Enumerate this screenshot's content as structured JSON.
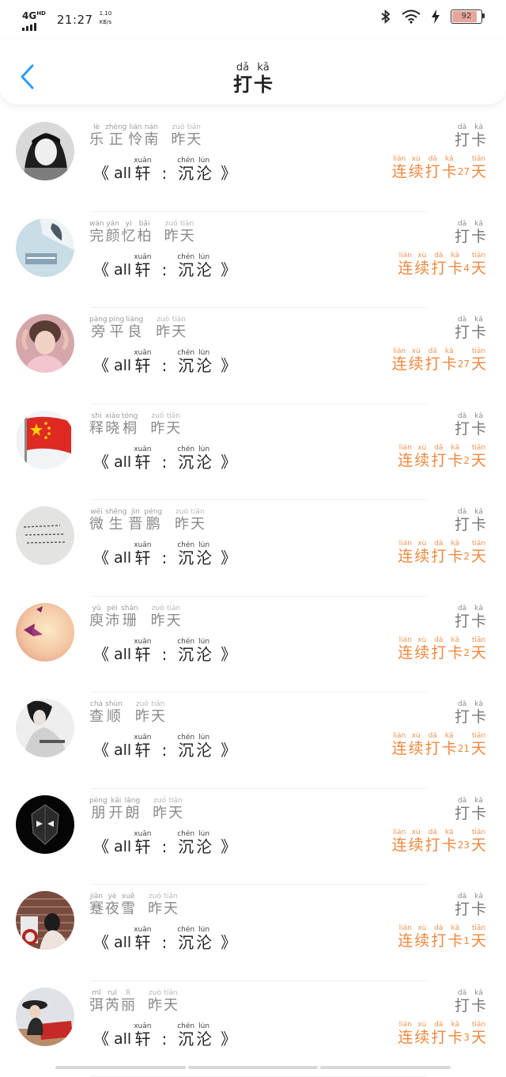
{
  "status": {
    "network": "4G",
    "network_sup": "HD",
    "time": "21:27",
    "speed_value": "1.10",
    "speed_unit": "KB/s",
    "battery": "92",
    "battery_level": 0.92
  },
  "header": {
    "title": [
      {
        "py": "dǎ",
        "hz": "打"
      },
      {
        "py": "kǎ",
        "hz": "卡"
      }
    ],
    "back_icon": "chevron-left-icon"
  },
  "common": {
    "yesterday": [
      {
        "py": "zuó",
        "hz": "昨"
      },
      {
        "py": "tiān",
        "hz": "天"
      }
    ],
    "checkin": [
      {
        "py": "dǎ",
        "hz": "打"
      },
      {
        "py": "kǎ",
        "hz": "卡"
      }
    ],
    "sub_open": "《",
    "sub_latin": "all",
    "sub_xuan": {
      "py": "xuān",
      "hz": "轩"
    },
    "sub_colon": ":",
    "sub_chen": [
      {
        "py": "chén",
        "hz": "沉"
      },
      {
        "py": "lún",
        "hz": "沦"
      }
    ],
    "sub_close": "》",
    "streak_prefix": [
      {
        "py": "lián",
        "hz": "连"
      },
      {
        "py": "xù",
        "hz": "续"
      },
      {
        "py": "dǎ",
        "hz": "打"
      },
      {
        "py": "kǎ",
        "hz": "卡"
      }
    ],
    "streak_suffix": {
      "py": "tiān",
      "hz": "天"
    }
  },
  "users": [
    {
      "name": [
        {
          "py": "lè",
          "hz": "乐"
        },
        {
          "py": "zhèng",
          "hz": "正"
        },
        {
          "py": "lián",
          "hz": "怜"
        },
        {
          "py": "nán",
          "hz": "南"
        }
      ],
      "days": "27",
      "avatar": "avatar-girl-bw"
    },
    {
      "name": [
        {
          "py": "wán",
          "hz": "完"
        },
        {
          "py": "yán",
          "hz": "颜"
        },
        {
          "py": "yì",
          "hz": "忆"
        },
        {
          "py": "bǎi",
          "hz": "柏"
        }
      ],
      "days": "4",
      "avatar": "avatar-blue-text"
    },
    {
      "name": [
        {
          "py": "páng",
          "hz": "旁"
        },
        {
          "py": "píng",
          "hz": "平"
        },
        {
          "py": "liáng",
          "hz": "良"
        }
      ],
      "days": "27",
      "avatar": "avatar-boy-pink"
    },
    {
      "name": [
        {
          "py": "shì",
          "hz": "释"
        },
        {
          "py": "xiǎo",
          "hz": "晓"
        },
        {
          "py": "tóng",
          "hz": "桐"
        }
      ],
      "days": "2",
      "avatar": "avatar-flag"
    },
    {
      "name": [
        {
          "py": "wēi",
          "hz": "微"
        },
        {
          "py": "shēng",
          "hz": "生"
        },
        {
          "py": "jìn",
          "hz": "晋"
        },
        {
          "py": "péng",
          "hz": "鹏"
        }
      ],
      "days": "2",
      "avatar": "avatar-handwriting"
    },
    {
      "name": [
        {
          "py": "yǔ",
          "hz": "庾"
        },
        {
          "py": "pèi",
          "hz": "沛"
        },
        {
          "py": "shān",
          "hz": "珊"
        }
      ],
      "days": "2",
      "avatar": "avatar-paper-crane"
    },
    {
      "name": [
        {
          "py": "chá",
          "hz": "查"
        },
        {
          "py": "shùn",
          "hz": "顺"
        }
      ],
      "days": "21",
      "avatar": "avatar-woman-bw"
    },
    {
      "name": [
        {
          "py": "péng",
          "hz": "朋"
        },
        {
          "py": "kāi",
          "hz": "开"
        },
        {
          "py": "lǎng",
          "hz": "朗"
        }
      ],
      "days": "23",
      "avatar": "avatar-mask-dark"
    },
    {
      "name": [
        {
          "py": "jiǎn",
          "hz": "蹇"
        },
        {
          "py": "yè",
          "hz": "夜"
        },
        {
          "py": "xuě",
          "hz": "雪"
        }
      ],
      "days": "1",
      "avatar": "avatar-brick-wall"
    },
    {
      "name": [
        {
          "py": "mǐ",
          "hz": "弭"
        },
        {
          "py": "ruì",
          "hz": "芮"
        },
        {
          "py": "lì",
          "hz": "丽"
        }
      ],
      "days": "3",
      "avatar": "avatar-kid-red"
    }
  ]
}
